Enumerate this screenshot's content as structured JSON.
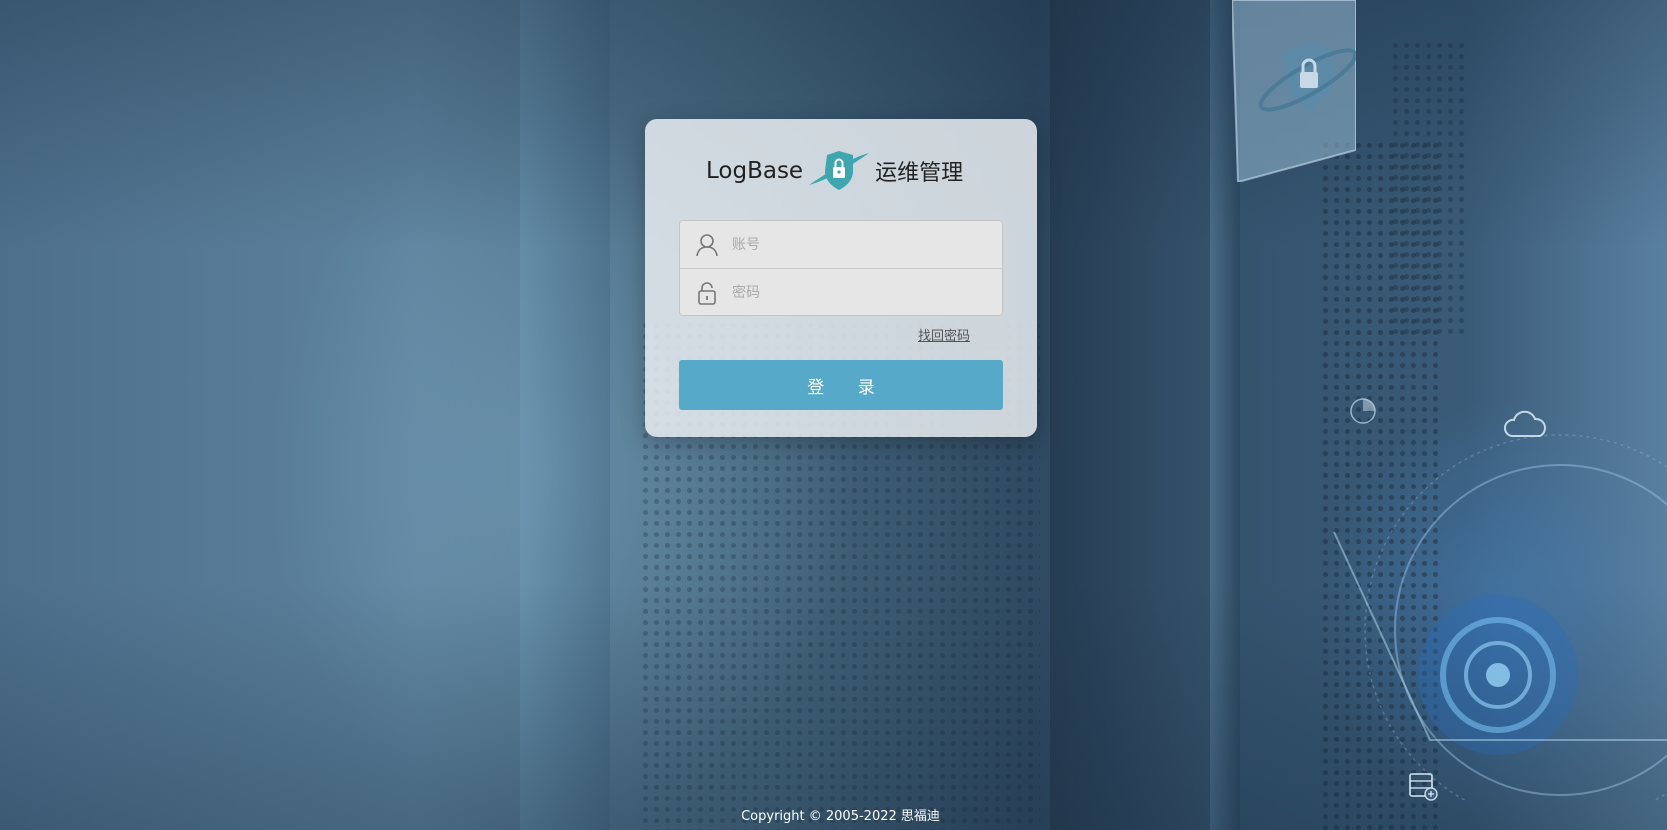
{
  "brand": {
    "name": "LogBase",
    "product": "运维管理",
    "accent_color": "#56a9c8",
    "shield_color": "#3fa6b0"
  },
  "login": {
    "account_placeholder": "账号",
    "password_placeholder": "密码",
    "forgot_label": "找回密码",
    "submit_label": "登 录",
    "account_icon": "user-icon",
    "password_icon": "lock-icon"
  },
  "footer": {
    "copyright": "Copyright © 2005-2022 思福迪"
  }
}
